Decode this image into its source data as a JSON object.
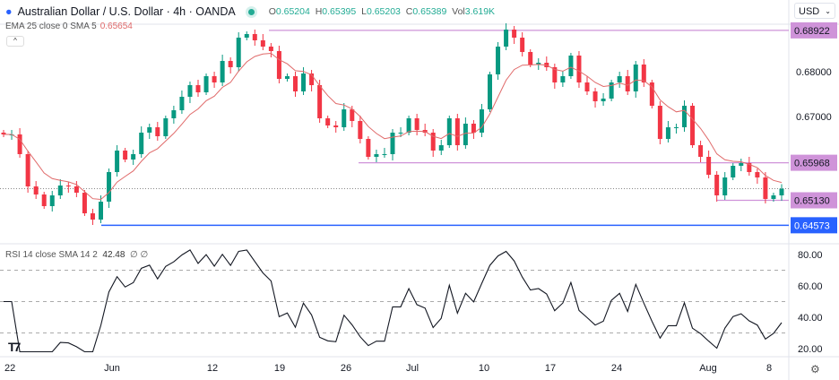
{
  "header": {
    "title": "Australian Dollar / U.S. Dollar · 4h · OANDA",
    "open_label": "O",
    "open": "0.65204",
    "high_label": "H",
    "high": "0.65395",
    "low_label": "L",
    "low": "0.65203",
    "close_label": "C",
    "close": "0.65389",
    "vol_label": "Vol",
    "vol": "3.619K"
  },
  "ema": {
    "label": "EMA 25 close 0 SMA 5",
    "value": "0.65654"
  },
  "rsi": {
    "label": "RSI 14 close SMA 14 2",
    "value": "42.48",
    "extra": "∅ ∅"
  },
  "currency": "USD",
  "collapse_icon": "chevron-up-icon",
  "colors": {
    "up": "#089981",
    "down": "#f23645",
    "level": "#cf93d9",
    "support": "#2962ff",
    "ema": "#e06a6a"
  },
  "chart_data": {
    "type": "candlestick",
    "title": "Australian Dollar / U.S. Dollar · 4h · OANDA",
    "ylim": [
      0.6425,
      0.6955
    ],
    "y_ticks": [
      "0.68000",
      "0.67000"
    ],
    "x_ticks": [
      "22",
      "Jun",
      "12",
      "19",
      "26",
      "Jul",
      "10",
      "17",
      "24",
      "Aug",
      "8"
    ],
    "closes": [
      0.666,
      0.666,
      0.6616,
      0.6544,
      0.6526,
      0.65,
      0.6524,
      0.6546,
      0.6544,
      0.653,
      0.6484,
      0.647,
      0.651,
      0.6576,
      0.6624,
      0.6604,
      0.6616,
      0.6664,
      0.6676,
      0.6656,
      0.6696,
      0.6714,
      0.6744,
      0.677,
      0.6754,
      0.679,
      0.6776,
      0.6824,
      0.681,
      0.6876,
      0.6884,
      0.687,
      0.6856,
      0.6846,
      0.6784,
      0.679,
      0.6756,
      0.6796,
      0.677,
      0.6696,
      0.668,
      0.6676,
      0.6716,
      0.669,
      0.665,
      0.661,
      0.6616,
      0.6616,
      0.6664,
      0.6664,
      0.6696,
      0.667,
      0.6664,
      0.6624,
      0.6636,
      0.6696,
      0.6636,
      0.6684,
      0.6664,
      0.6716,
      0.6794,
      0.6856,
      0.6894,
      0.6876,
      0.6844,
      0.6816,
      0.682,
      0.681,
      0.6776,
      0.679,
      0.6836,
      0.6776,
      0.6756,
      0.6734,
      0.674,
      0.6776,
      0.679,
      0.6756,
      0.6816,
      0.6776,
      0.6724,
      0.665,
      0.6676,
      0.6676,
      0.6724,
      0.6636,
      0.661,
      0.657,
      0.6524,
      0.6564,
      0.659,
      0.6596,
      0.6576,
      0.6564,
      0.6516,
      0.6524,
      0.65389
    ],
    "levels": [
      {
        "price": 0.68922,
        "label": "0.68922",
        "kind": "resistance"
      },
      {
        "price": 0.65968,
        "label": "0.65968",
        "kind": "resistance"
      },
      {
        "price": 0.6513,
        "label": "0.65130",
        "kind": "support"
      },
      {
        "price": 0.64573,
        "label": "0.64573",
        "kind": "major-support"
      }
    ],
    "current_price": 0.65389,
    "rsi_ticks": [
      "80.00",
      "60.00",
      "40.00",
      "20.00"
    ],
    "rsi_bands": [
      70,
      50,
      30
    ]
  }
}
